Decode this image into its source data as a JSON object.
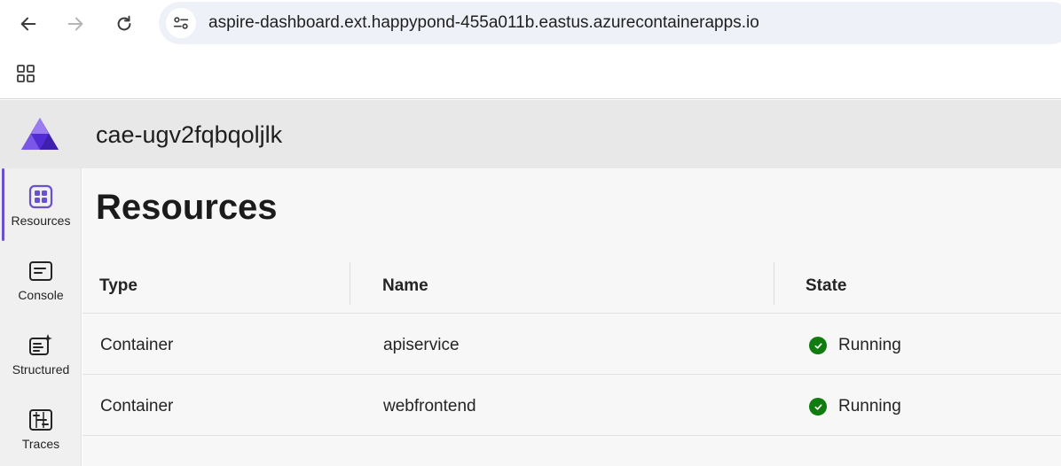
{
  "browser": {
    "url": "aspire-dashboard.ext.happypond-455a011b.eastus.azurecontainerapps.io"
  },
  "app": {
    "title": "cae-ugv2fqbqoljlk",
    "accent_color": "#6b4fd1"
  },
  "sidebar": {
    "items": [
      {
        "label": "Resources",
        "icon": "resources-icon",
        "active": true
      },
      {
        "label": "Console",
        "icon": "console-icon",
        "active": false
      },
      {
        "label": "Structured",
        "icon": "structured-icon",
        "active": false
      },
      {
        "label": "Traces",
        "icon": "traces-icon",
        "active": false
      }
    ]
  },
  "main": {
    "title": "Resources",
    "columns": [
      "Type",
      "Name",
      "State"
    ],
    "rows": [
      {
        "type": "Container",
        "name": "apiservice",
        "state": "Running"
      },
      {
        "type": "Container",
        "name": "webfrontend",
        "state": "Running"
      }
    ],
    "running_color": "#107c10"
  }
}
